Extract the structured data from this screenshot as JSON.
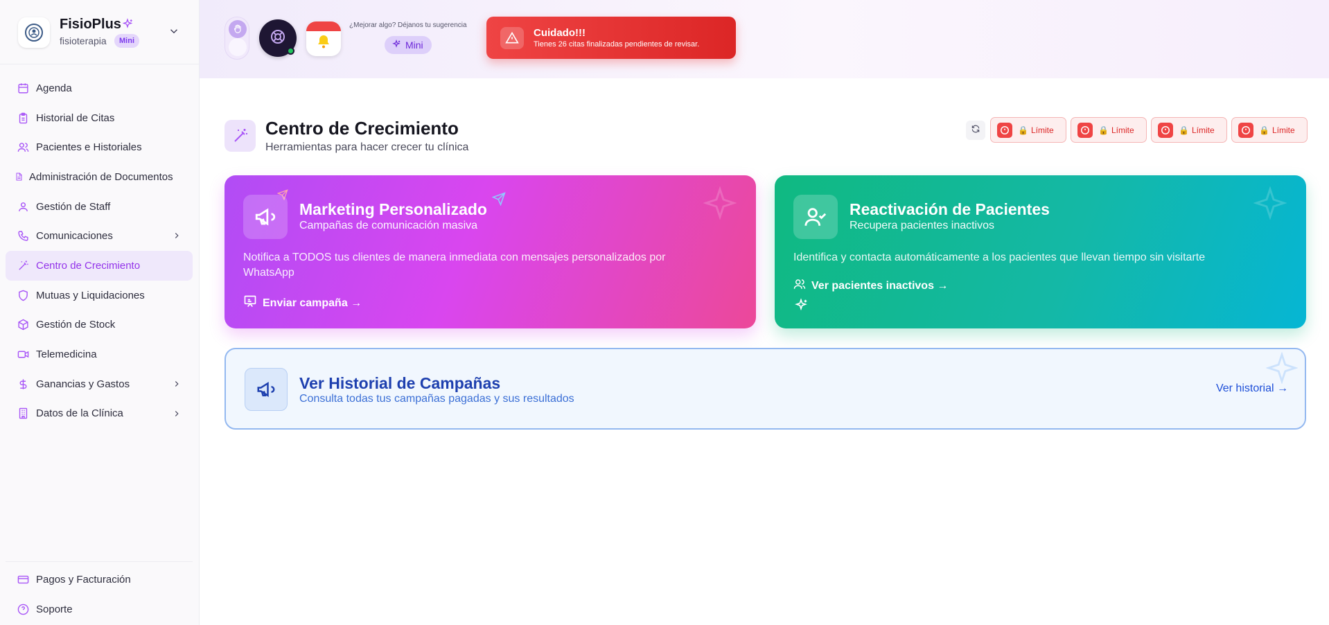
{
  "brand": {
    "name": "FisioPlus",
    "subtitle": "fisioterapia",
    "plan": "Mini"
  },
  "sidebar": {
    "items": [
      {
        "label": "Agenda",
        "icon": "calendar-icon"
      },
      {
        "label": "Historial de Citas",
        "icon": "clipboard-icon"
      },
      {
        "label": "Pacientes e Historiales",
        "icon": "users-icon"
      },
      {
        "label": "Administración de Documentos",
        "icon": "document-icon"
      },
      {
        "label": "Gestión de Staff",
        "icon": "user-icon"
      },
      {
        "label": "Comunicaciones",
        "icon": "phone-icon"
      },
      {
        "label": "Centro de Crecimiento",
        "icon": "magic-wand-icon",
        "active": true
      },
      {
        "label": "Mutuas y Liquidaciones",
        "icon": "shield-icon"
      },
      {
        "label": "Gestión de Stock",
        "icon": "box-icon"
      },
      {
        "label": "Telemedicina",
        "icon": "video-icon"
      },
      {
        "label": "Ganancias y Gastos",
        "icon": "dollar-icon"
      },
      {
        "label": "Datos de la Clínica",
        "icon": "building-icon"
      }
    ],
    "footer": [
      {
        "label": "Pagos y Facturación",
        "icon": "credit-card-icon"
      },
      {
        "label": "Soporte",
        "icon": "help-circle-icon"
      }
    ]
  },
  "header": {
    "suggestion_text": "¿Mejorar algo? Déjanos tu sugerencia",
    "suggestion_button": "Mini",
    "alert": {
      "title": "Cuidado!!!",
      "text": "Tienes 26 citas finalizadas pendientes de revisar."
    }
  },
  "page": {
    "title": "Centro de Crecimiento",
    "subtitle": "Herramientas para hacer crecer tu clínica",
    "limits": [
      "Límite",
      "Límite",
      "Límite",
      "Límite"
    ]
  },
  "cards": {
    "marketing": {
      "title": "Marketing Personalizado",
      "subtitle": "Campañas de comunicación masiva",
      "description": "Notifica a TODOS tus clientes de manera inmediata con mensajes personalizados por WhatsApp",
      "action": "Enviar campaña →"
    },
    "reactivation": {
      "title": "Reactivación de Pacientes",
      "subtitle": "Recupera pacientes inactivos",
      "description": "Identifica y contacta automáticamente a los pacientes que llevan tiempo sin visitarte",
      "action": "Ver pacientes inactivos →"
    },
    "history": {
      "title": "Ver Historial de Campañas",
      "subtitle": "Consulta todas tus campañas pagadas y sus resultados",
      "link": "Ver historial →"
    }
  },
  "colors": {
    "accent": "#9333ea",
    "alert": "#ef4444",
    "marketing_gradient": [
      "#b14cf5",
      "#ec4899"
    ],
    "reactivation_gradient": [
      "#10b981",
      "#06b6d4"
    ],
    "history_border": "#93b8f0"
  }
}
